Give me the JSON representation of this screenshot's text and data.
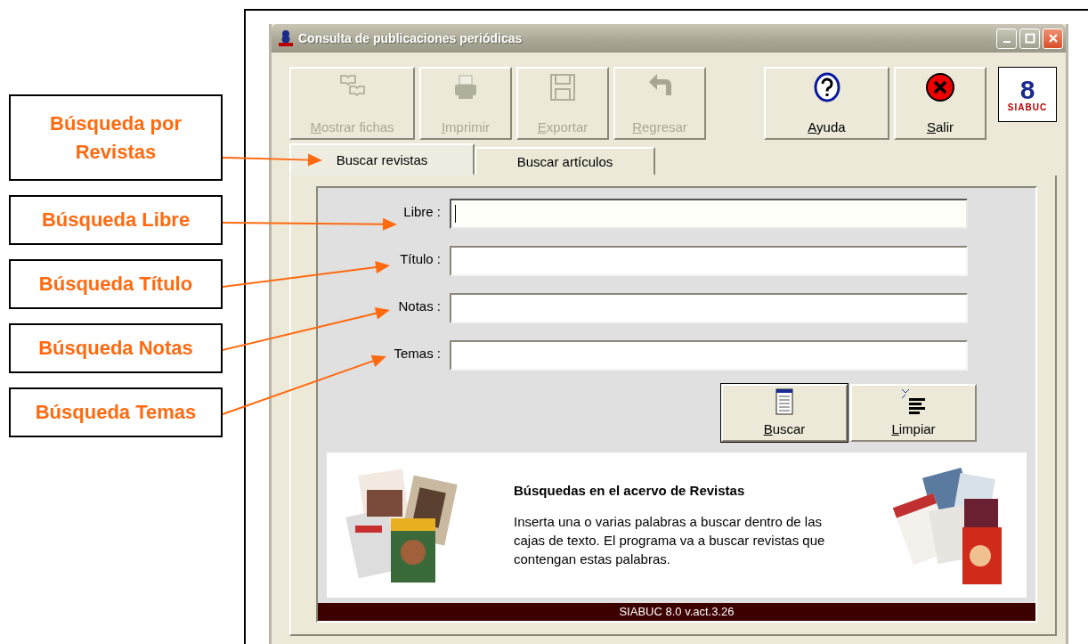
{
  "callouts": [
    {
      "text": "Búsqueda por Revistas"
    },
    {
      "text": "Búsqueda Libre"
    },
    {
      "text": "Búsqueda Título"
    },
    {
      "text": "Búsqueda Notas"
    },
    {
      "text": "Búsqueda Temas"
    }
  ],
  "window": {
    "title": "Consulta de publicaciones periódicas"
  },
  "toolbar": [
    {
      "label": "Mostrar fichas",
      "disabled": true
    },
    {
      "label": "Imprimir",
      "disabled": true
    },
    {
      "label": "Exportar",
      "disabled": true
    },
    {
      "label": "Regresar",
      "disabled": true
    }
  ],
  "toolbar_right": [
    {
      "label": "Ayuda",
      "disabled": false
    },
    {
      "label": "Salir",
      "disabled": false
    }
  ],
  "logo": {
    "number": "8",
    "name": "SIABUC"
  },
  "tabs": [
    {
      "label": "Buscar revistas",
      "selected": true
    },
    {
      "label": "Buscar artículos",
      "selected": false
    }
  ],
  "fields": [
    {
      "label": "Libre :",
      "focused": true
    },
    {
      "label": "Título :",
      "focused": false
    },
    {
      "label": "Notas :",
      "focused": false
    },
    {
      "label": "Temas :",
      "focused": false
    }
  ],
  "actions": [
    {
      "label": "Buscar",
      "default": true
    },
    {
      "label": "Limpiar",
      "default": false
    }
  ],
  "info": {
    "heading": "Búsquedas en el acervo de Revistas",
    "text": "Inserta una o varias palabras a buscar dentro de las cajas de texto. El programa va a buscar revistas que contengan estas palabras."
  },
  "status_bar": "SIABUC 8.0 v.act.3.26"
}
